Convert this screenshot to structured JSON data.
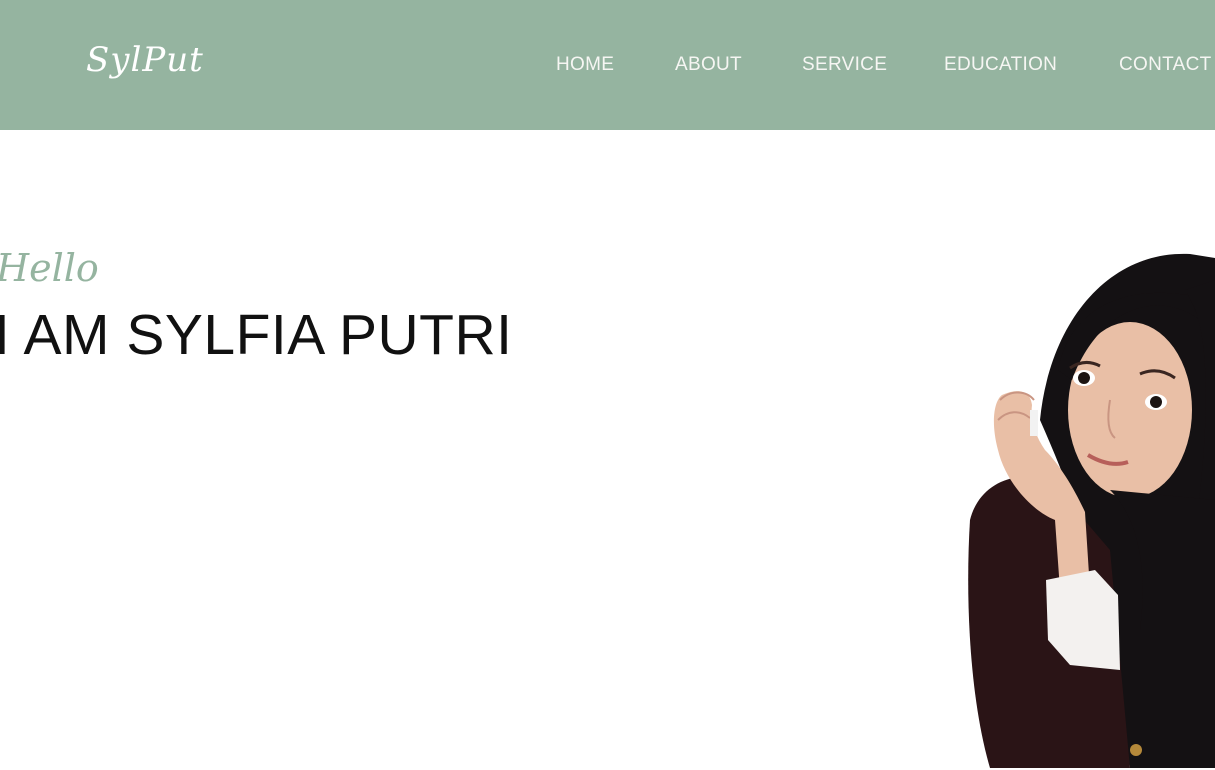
{
  "header": {
    "logo": "SylPut",
    "nav": [
      {
        "label": "HOME"
      },
      {
        "label": "ABOUT"
      },
      {
        "label": "SERVICE"
      },
      {
        "label": "EDUCATION"
      },
      {
        "label": "CONTACT"
      }
    ]
  },
  "hero": {
    "greeting": "Hello",
    "title": "I AM SYLFIA PUTRI"
  },
  "colors": {
    "navbar_bg": "#95b4a0",
    "nav_text": "#f6f6f3",
    "accent": "#95b4a0",
    "title_text": "#111111"
  }
}
